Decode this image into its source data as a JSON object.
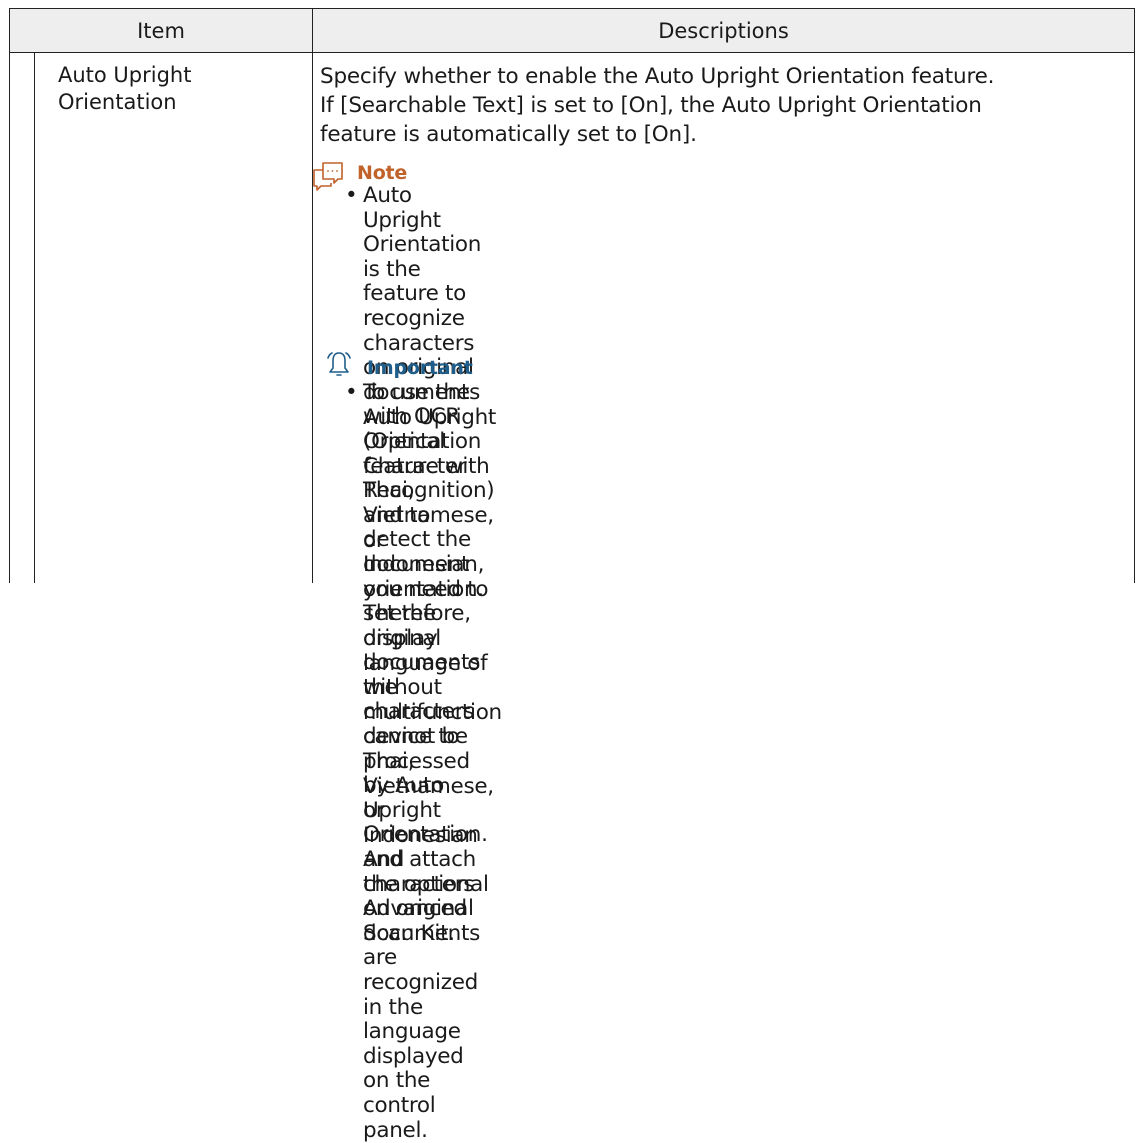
{
  "table": {
    "headers": {
      "item": "Item",
      "descriptions": "Descriptions"
    },
    "row": {
      "item_lines": [
        "Auto Upright",
        "Orientation"
      ],
      "description_lines": [
        "Specify whether to enable the Auto Upright Orientation feature.",
        "If [Searchable Text] is set to [On], the Auto Upright Orientation",
        "feature is automatically set to [On]."
      ],
      "note": {
        "icon": "note-speech-icon",
        "title": "Note",
        "bullet": "•",
        "lines": [
          "Auto Upright Orientation is the feature to recognize",
          "characters on original documents with OCR (Optical",
          "Character Recognition) and to detect the document",
          "orientation. Therefore, original documents without",
          "characters cannot be processed by Auto Upright",
          "Orientation. And characters on original documents are",
          "recognized in the language displayed on the control panel."
        ]
      },
      "important": {
        "icon": "bell-icon",
        "title": "Important",
        "bullet": "•",
        "lines": [
          "To use the Auto Upright Orientation feature with Thai,",
          "Vietnamese, or Indonesian, you need to set the display",
          "language of the multifunction device to Thai, Vietnamese,",
          "or Indonesian and attach the optional Advanced Scan Kit."
        ]
      }
    }
  },
  "colors": {
    "note_accent": "#c0622a",
    "important_accent": "#1f5e8a",
    "header_bg": "#eeeeee",
    "border": "#222222"
  }
}
